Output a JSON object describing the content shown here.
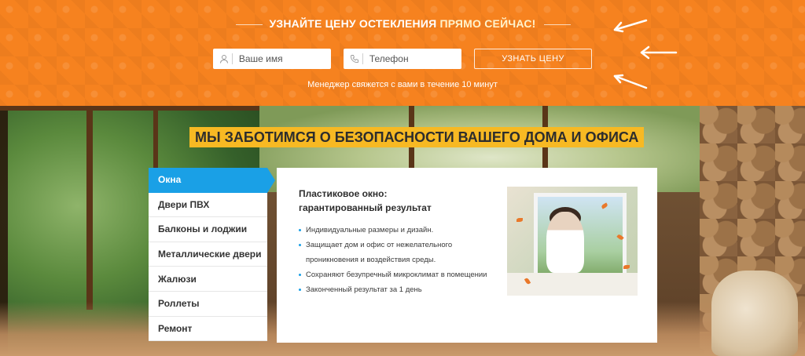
{
  "banner": {
    "title_part1": "УЗНАЙТЕ ЦЕНУ ОСТЕКЛЕНИЯ",
    "title_part2": "ПРЯМО СЕЙЧАС!",
    "name_placeholder": "Ваше имя",
    "phone_placeholder": "Телефон",
    "submit_label": "УЗНАТЬ ЦЕНУ",
    "note": "Менеджер свяжется с вами в течение 10 минут",
    "icons": {
      "name": "user-icon",
      "phone": "phone-icon"
    },
    "color": "#f6821f"
  },
  "headline": "МЫ ЗАБОТИМСЯ О БЕЗОПАСНОСТИ ВАШЕГО ДОМА И ОФИСА",
  "menu": {
    "items": [
      {
        "label": "Окна",
        "active": true
      },
      {
        "label": "Двери ПВХ",
        "active": false
      },
      {
        "label": "Балконы и лоджии",
        "active": false
      },
      {
        "label": "Металлические двери",
        "active": false
      },
      {
        "label": "Жалюзи",
        "active": false
      },
      {
        "label": "Роллеты",
        "active": false
      },
      {
        "label": "Ремонт",
        "active": false
      }
    ],
    "active_color": "#1aa0e6"
  },
  "card": {
    "title_line1": "Пластиковое окно:",
    "title_line2": "гарантированный результат",
    "features": [
      "Индивидуальные размеры и дизайн.",
      "Защищает дом и офис от нежелательного проникновения и воздействия среды.",
      "Сохраняют безупречный микроклимат в помещении",
      "Законченный результат за 1 день"
    ]
  }
}
